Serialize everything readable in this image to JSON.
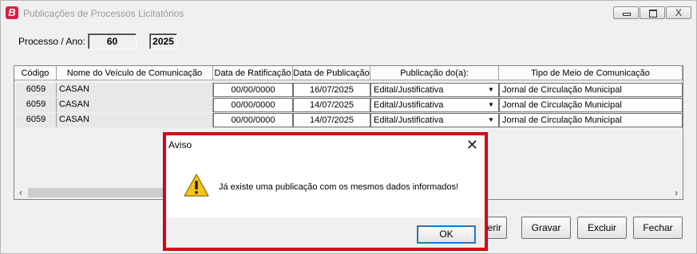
{
  "window": {
    "title": "Publicações de Processos Licitatórios",
    "app_icon_letter": "B",
    "close_glyph": "X"
  },
  "processo": {
    "label": "Processo / Ano:",
    "numero": "60",
    "ano": "2025"
  },
  "grid": {
    "columns": [
      "Código",
      "Nome do Veículo de Comunicação",
      "Data de Ratificação",
      "Data de Publicação",
      "Publicação do(a):",
      "Tipo de  Meio de Comunicação"
    ],
    "rows": [
      {
        "codigo": "6059",
        "nome": "CASAN",
        "ratificacao": "00/00/0000",
        "publicacao": "16/07/2025",
        "tipo_pub": "Edital/Justificativa",
        "meio": "Jornal de Circulação Municipal"
      },
      {
        "codigo": "6059",
        "nome": "CASAN",
        "ratificacao": "00/00/0000",
        "publicacao": "14/07/2025",
        "tipo_pub": "Edital/Justificativa",
        "meio": "Jornal de Circulação Municipal"
      },
      {
        "codigo": "6059",
        "nome": "CASAN",
        "ratificacao": "00/00/0000",
        "publicacao": "14/07/2025",
        "tipo_pub": "Edital/Justificativa",
        "meio": "Jornal de Circulação Municipal"
      }
    ]
  },
  "buttons": {
    "inserir_partial": "serir",
    "gravar": "Gravar",
    "excluir": "Excluir",
    "fechar": "Fechar"
  },
  "dialog": {
    "title": "Aviso",
    "message": "Já existe uma publicação com os mesmos dados informados!",
    "ok": "OK",
    "close_glyph": "✕",
    "border_color": "#e0001a"
  }
}
